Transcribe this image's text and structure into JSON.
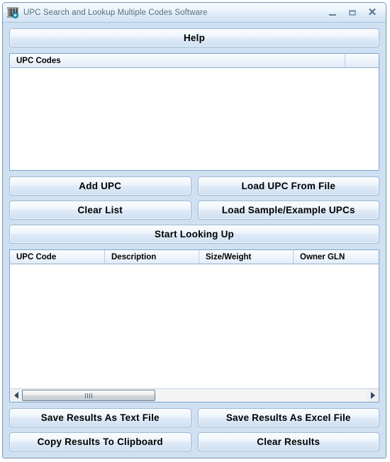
{
  "window": {
    "title": "UPC Search and Lookup Multiple Codes Software",
    "icon": "barcode-icon",
    "controls": {
      "minimize": "minimize-button",
      "maximize": "maximize-button",
      "close": "close-button"
    }
  },
  "toolbar": {
    "help_label": "Help"
  },
  "upc_codes_panel": {
    "columns": [
      "UPC Codes",
      ""
    ],
    "rows": []
  },
  "input_actions": {
    "add_upc": "Add UPC",
    "load_upc_from_file": "Load UPC From File",
    "clear_list": "Clear List",
    "load_sample_upcs": "Load Sample/Example UPCs"
  },
  "start_action": {
    "label": "Start Looking Up"
  },
  "results_panel": {
    "columns": [
      "UPC Code",
      "Description",
      "Size/Weight",
      "Owner GLN"
    ],
    "rows": [],
    "scrollbar": {
      "left_arrow": "scroll-left-arrow",
      "right_arrow": "scroll-right-arrow",
      "thumb": "scroll-thumb"
    }
  },
  "results_actions": {
    "save_text": "Save Results As Text File",
    "save_excel": "Save Results As Excel File",
    "copy_clipboard": "Copy Results To Clipboard",
    "clear_results": "Clear Results"
  },
  "colors": {
    "window_background": "#cfe0f3",
    "titlebar_top": "#f4f9fd",
    "titlebar_bottom": "#d2e3f4",
    "border": "#7a93ad",
    "button_border": "#9fb8d2",
    "list_border": "#7fa5c9",
    "title_text": "#5a6d80"
  }
}
